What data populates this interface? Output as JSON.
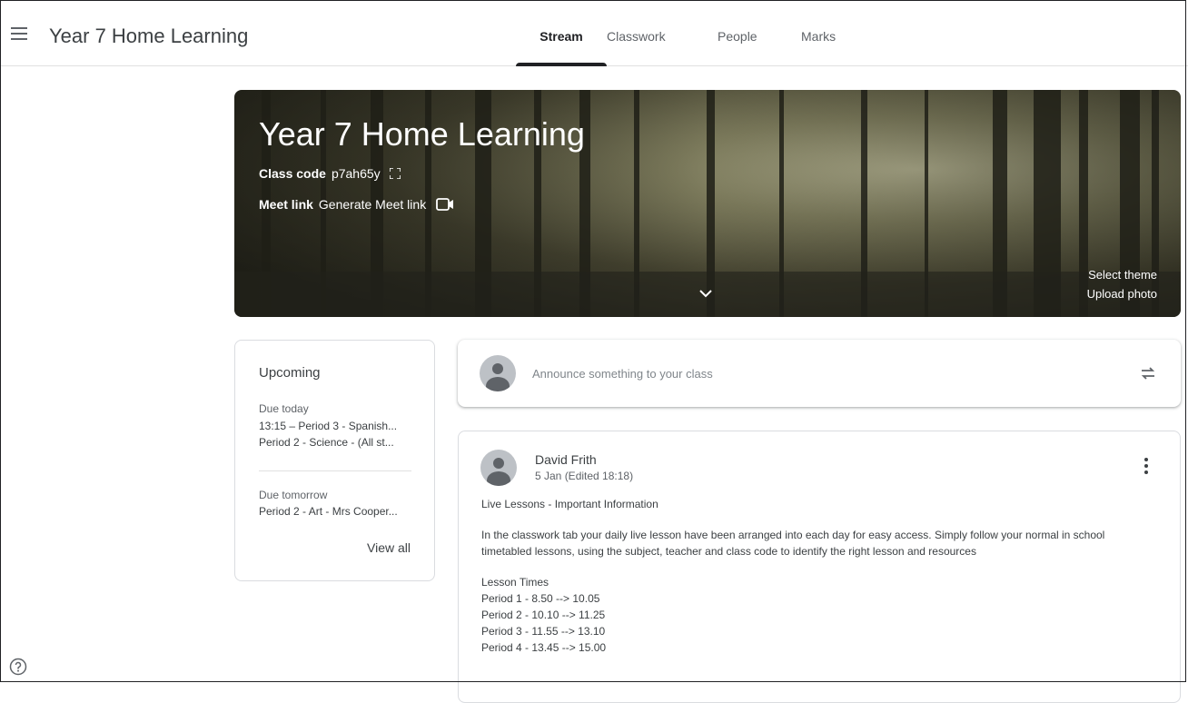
{
  "header": {
    "title": "Year 7 Home Learning",
    "tabs": [
      {
        "label": "Stream",
        "active": true
      },
      {
        "label": "Classwork",
        "active": false
      },
      {
        "label": "People",
        "active": false
      },
      {
        "label": "Marks",
        "active": false
      }
    ]
  },
  "banner": {
    "title": "Year 7 Home Learning",
    "class_code_label": "Class code",
    "class_code": "p7ah65y",
    "meet_label": "Meet link",
    "meet_value": "Generate Meet link",
    "select_theme": "Select theme",
    "upload_photo": "Upload photo"
  },
  "upcoming": {
    "title": "Upcoming",
    "due_today_label": "Due today",
    "due_today": [
      "13:15 – Period 3 - Spanish...",
      "Period 2 - Science - (All st..."
    ],
    "due_tomorrow_label": "Due tomorrow",
    "due_tomorrow": [
      "Period 2 - Art - Mrs Cooper..."
    ],
    "view_all": "View all"
  },
  "announce": {
    "placeholder": "Announce something to your class"
  },
  "post": {
    "author": "David Frith",
    "date": "5 Jan (Edited 18:18)",
    "heading": "Live Lessons - Important Information",
    "paragraph": "In the classwork tab your daily live lesson have been arranged into each day for easy access. Simply follow your normal in school timetabled lessons, using the subject, teacher and class code to identify the right lesson and resources",
    "times_label": "Lesson Times",
    "times": [
      "Period 1 - 8.50 --> 10.05",
      "Period 2 - 10.10 --> 11.25",
      "Period 3 - 11.55 --> 13.10",
      "Period 4 - 13.45 --> 15.00"
    ]
  },
  "colors": {
    "active_tab": "#202124",
    "text": "#3c4043",
    "muted": "#5f6368",
    "border": "#dadce0"
  },
  "icons": [
    "menu-icon",
    "fullscreen-icon",
    "video-camera-icon",
    "chevron-down-icon",
    "repost-icon",
    "more-vert-icon",
    "help-icon",
    "avatar-icon"
  ]
}
